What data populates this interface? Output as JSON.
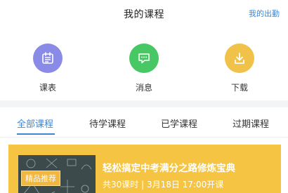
{
  "header": {
    "title": "我的课程",
    "right_link": "我的出勤"
  },
  "actions": [
    {
      "label": "课表",
      "icon": "calendar-icon",
      "color": "#8a8be6"
    },
    {
      "label": "消息",
      "icon": "chat-icon",
      "color": "#48c765"
    },
    {
      "label": "下载",
      "icon": "download-icon",
      "color": "#f0c24a"
    }
  ],
  "tabs": [
    {
      "label": "全部课程",
      "active": true
    },
    {
      "label": "待学课程",
      "active": false
    },
    {
      "label": "已学课程",
      "active": false
    },
    {
      "label": "过期课程",
      "active": false
    }
  ],
  "course": {
    "badge": "精品推荐",
    "title": "轻松搞定中考满分之路修炼宝典",
    "meta": "共30课时 | 3月18日 17:00开课"
  },
  "colors": {
    "accent": "#3d86d6",
    "card_bg": "#f6c443"
  }
}
